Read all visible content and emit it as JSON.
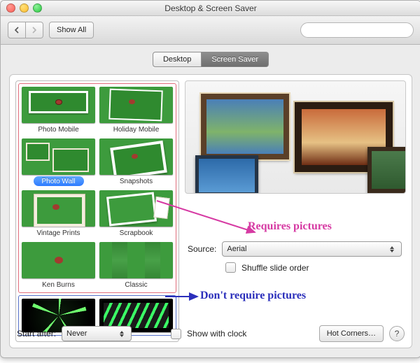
{
  "window": {
    "title": "Desktop & Screen Saver"
  },
  "toolbar": {
    "show_all": "Show All",
    "search_placeholder": ""
  },
  "tabs": {
    "desktop": "Desktop",
    "screensaver": "Screen Saver",
    "selected": "screensaver"
  },
  "screensavers": {
    "requires_pictures": [
      {
        "id": "photo-mobile",
        "label": "Photo Mobile"
      },
      {
        "id": "holiday-mobile",
        "label": "Holiday Mobile"
      },
      {
        "id": "photo-wall",
        "label": "Photo Wall",
        "selected": true
      },
      {
        "id": "snapshots",
        "label": "Snapshots"
      },
      {
        "id": "vintage-prints",
        "label": "Vintage Prints"
      },
      {
        "id": "scrapbook",
        "label": "Scrapbook"
      },
      {
        "id": "ken-burns",
        "label": "Ken Burns"
      },
      {
        "id": "classic",
        "label": "Classic"
      }
    ],
    "no_pictures": [
      {
        "id": "abstract-1",
        "label": ""
      },
      {
        "id": "abstract-2",
        "label": ""
      }
    ]
  },
  "source": {
    "label": "Source:",
    "value": "Aerial"
  },
  "shuffle": {
    "label": "Shuffle slide order",
    "checked": false
  },
  "start_after": {
    "label": "Start after:",
    "value": "Never"
  },
  "show_clock": {
    "label": "Show with clock",
    "checked": false
  },
  "hot_corners": {
    "label": "Hot Corners…"
  },
  "help": {
    "label": "?"
  },
  "annotations": {
    "requires": "Requires pictures",
    "noreq": "Don't require pictures",
    "colors": {
      "requires": "#d63aa3",
      "noreq": "#2b2fbb"
    }
  }
}
